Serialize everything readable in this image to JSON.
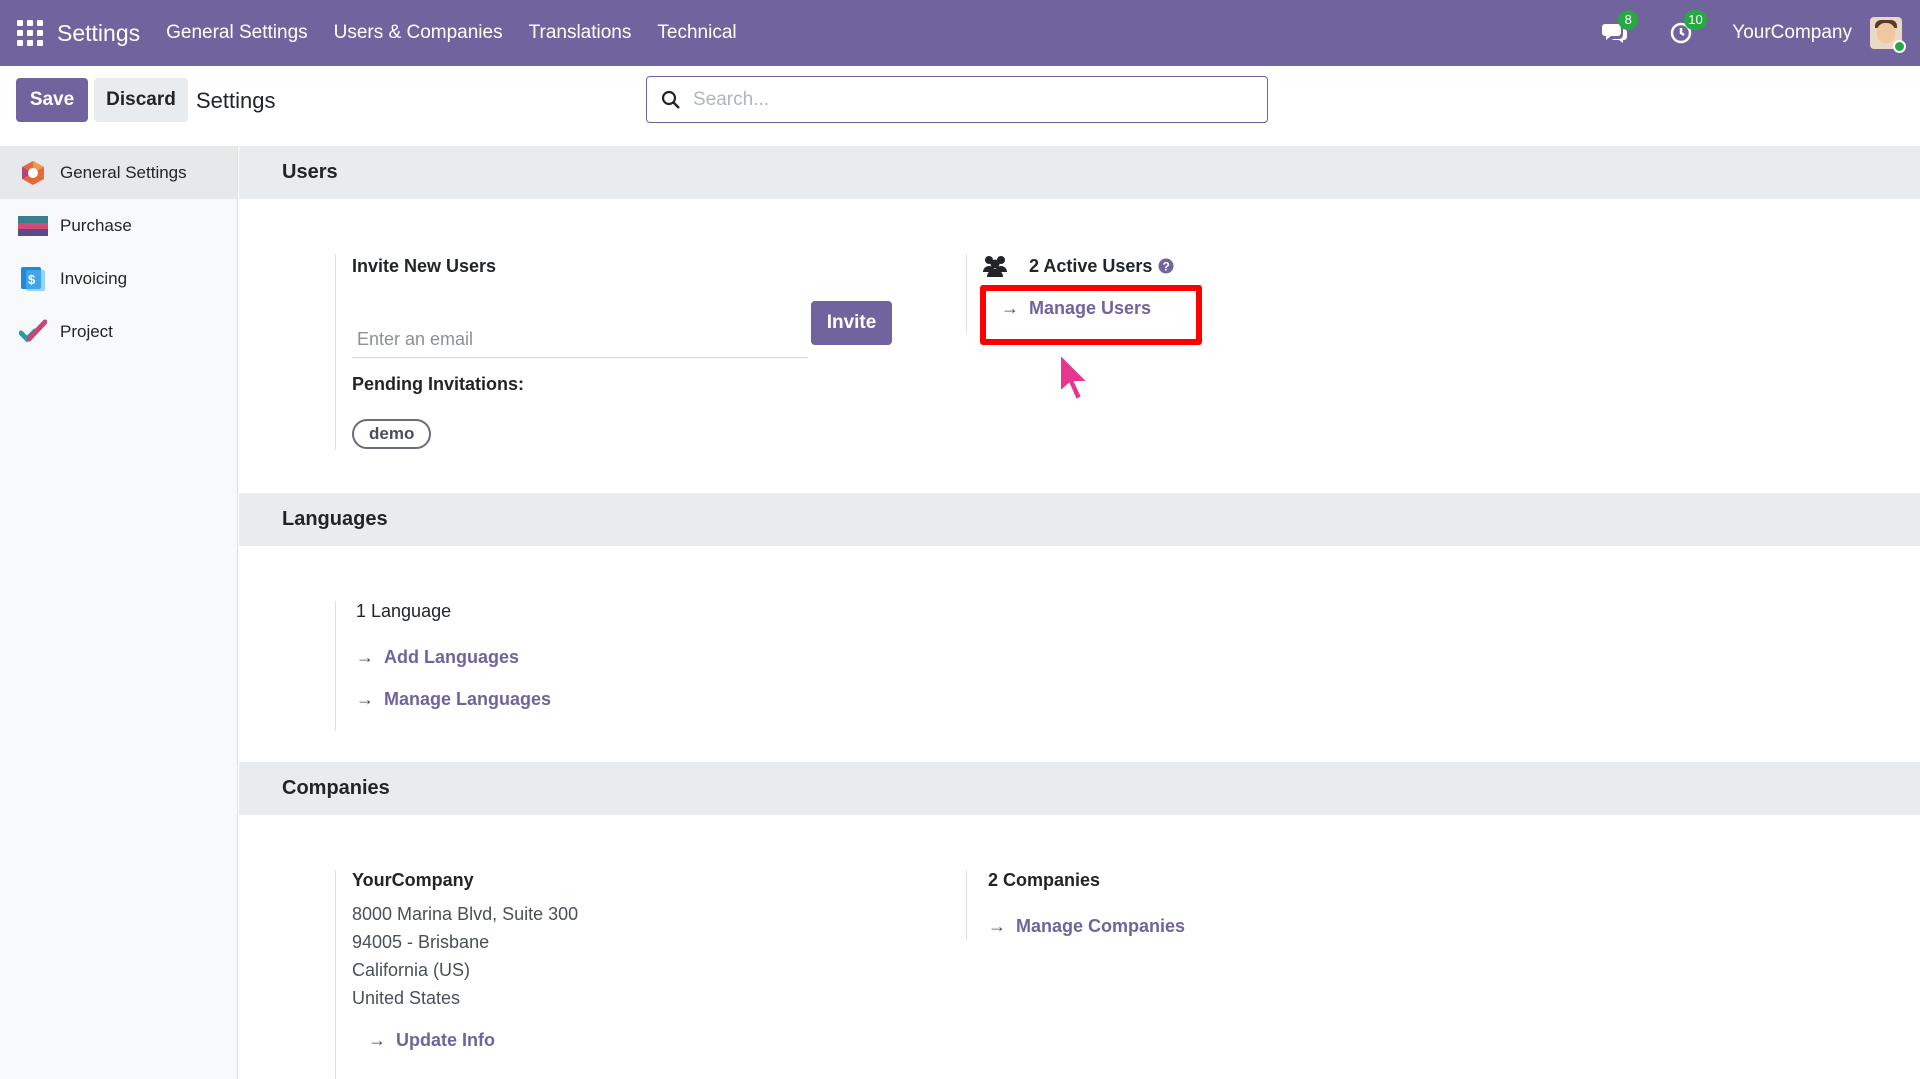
{
  "navbar": {
    "app_name": "Settings",
    "menu": [
      "General Settings",
      "Users & Companies",
      "Translations",
      "Technical"
    ],
    "messages_badge": "8",
    "activities_badge": "10",
    "company": "YourCompany"
  },
  "control_panel": {
    "save_label": "Save",
    "discard_label": "Discard",
    "title": "Settings",
    "search_placeholder": "Search..."
  },
  "sidebar": {
    "items": [
      {
        "label": "General Settings",
        "icon": "settings-app-icon",
        "active": true
      },
      {
        "label": "Purchase",
        "icon": "purchase-app-icon"
      },
      {
        "label": "Invoicing",
        "icon": "invoicing-app-icon"
      },
      {
        "label": "Project",
        "icon": "project-app-icon"
      }
    ]
  },
  "users": {
    "title": "Users",
    "invite_label": "Invite New Users",
    "email_placeholder": "Enter an email",
    "invite_button": "Invite",
    "pending_label": "Pending Invitations:",
    "pending": [
      "demo"
    ],
    "active_users": "2 Active Users",
    "manage_users": "Manage Users"
  },
  "languages": {
    "title": "Languages",
    "count": "1 Language",
    "add": "Add Languages",
    "manage": "Manage Languages"
  },
  "companies": {
    "title": "Companies",
    "name": "YourCompany",
    "address": [
      "8000 Marina Blvd, Suite 300",
      "94005 - Brisbane",
      "California (US)",
      "United States"
    ],
    "update": "Update Info",
    "count": "2 Companies",
    "manage": "Manage Companies"
  },
  "colors": {
    "brand": "#71639e",
    "highlight": "#ff0000",
    "badge": "#28a745"
  }
}
